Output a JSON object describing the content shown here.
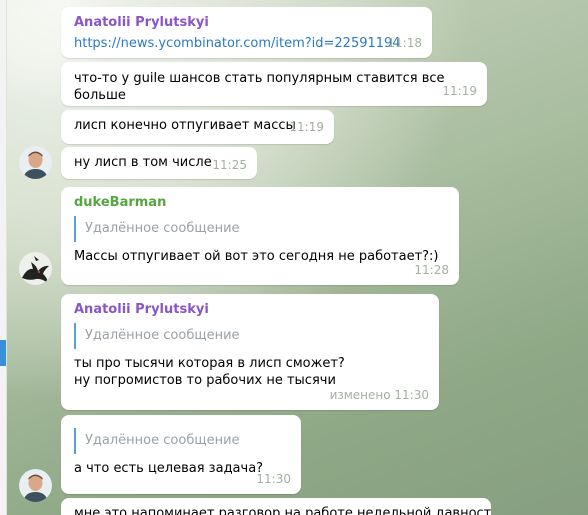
{
  "messages": [
    {
      "sender": "Anatolii Prylutskyi",
      "link": "https://news.ycombinator.com/item?id=22591194",
      "time": "11:18"
    },
    {
      "text": "что-то у guile шансов стать популярным ставится все больше",
      "time": "11:19"
    },
    {
      "text": "лисп конечно отпугивает массы",
      "time": "11:19"
    },
    {
      "text": "ну лисп в том числе",
      "time": "11:25"
    },
    {
      "sender": "dukeBarman",
      "reply": "Удалённое сообщение",
      "text": "Массы отпугивает ой вот это сегодня не работает?:)",
      "time": "11:28"
    },
    {
      "sender": "Anatolii Prylutskyi",
      "reply": "Удалённое сообщение",
      "text_line1": "ты про тысячи которая в лисп сможет?",
      "text_line2": "ну погромистов то рабочих не тысячи",
      "time": "изменено 11:30"
    },
    {
      "reply": "Удалённое сообщение",
      "text": "а что есть целевая задача?",
      "time": "11:30"
    },
    {
      "text_partial": "мне это напоминает разговор на работе недельной давности"
    }
  ],
  "avatars": {
    "user1": "person-avatar-icon",
    "dukeBarman": "dragon-avatar-icon"
  },
  "colors": {
    "anatolii": "#8a55c4",
    "duke": "#56a640",
    "link": "#2a7ac2",
    "reply_bar": "#58a0d8",
    "time": "#a3b1a1"
  }
}
